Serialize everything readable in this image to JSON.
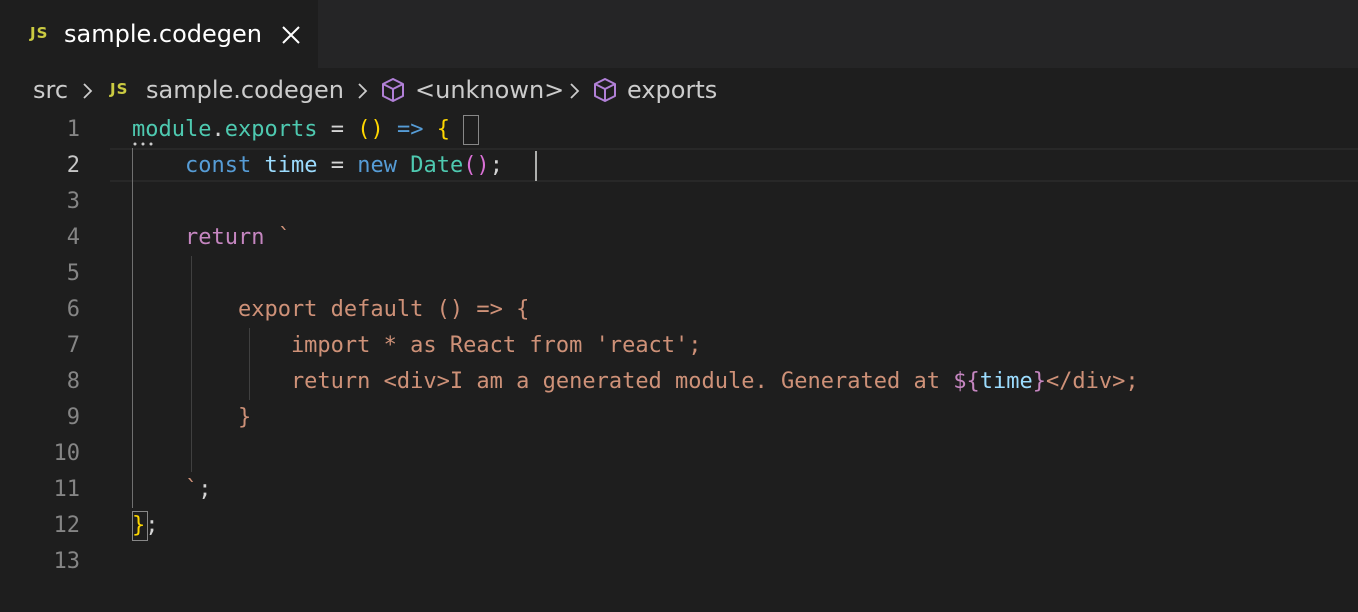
{
  "tab": {
    "icon_label": "JS",
    "title": "sample.codegen"
  },
  "breadcrumb": {
    "items": [
      {
        "label": "src"
      },
      {
        "label": "sample.codegen",
        "icon_label": "JS"
      },
      {
        "label": "<unknown>",
        "icon": "cube-icon"
      },
      {
        "label": "exports",
        "icon": "cube-icon"
      }
    ]
  },
  "editor": {
    "active_line": 2,
    "line_numbers": [
      "1",
      "2",
      "3",
      "4",
      "5",
      "6",
      "7",
      "8",
      "9",
      "10",
      "11",
      "12",
      "13"
    ],
    "lines": [
      [
        {
          "t": "module",
          "c": "mod"
        },
        {
          "t": ".",
          "c": "punc"
        },
        {
          "t": "exports",
          "c": "prop"
        },
        {
          "t": " = ",
          "c": "punc"
        },
        {
          "t": "()",
          "c": "brace-gold"
        },
        {
          "t": " ",
          "c": "punc"
        },
        {
          "t": "=>",
          "c": "arrow"
        },
        {
          "t": " ",
          "c": "punc"
        },
        {
          "t": "{",
          "c": "brace-gold"
        }
      ],
      [
        {
          "t": "    ",
          "c": "punc"
        },
        {
          "t": "const",
          "c": "kw-blue"
        },
        {
          "t": " ",
          "c": "punc"
        },
        {
          "t": "time",
          "c": "var"
        },
        {
          "t": " = ",
          "c": "punc"
        },
        {
          "t": "new",
          "c": "kw-blue"
        },
        {
          "t": " ",
          "c": "punc"
        },
        {
          "t": "Date",
          "c": "cls"
        },
        {
          "t": "()",
          "c": "brace-pink"
        },
        {
          "t": ";",
          "c": "punc"
        }
      ],
      [],
      [
        {
          "t": "    ",
          "c": "punc"
        },
        {
          "t": "return",
          "c": "kw-purple"
        },
        {
          "t": " `",
          "c": "str"
        }
      ],
      [],
      [
        {
          "t": "        export default () => {",
          "c": "str"
        }
      ],
      [
        {
          "t": "            import * as React from 'react';",
          "c": "str"
        }
      ],
      [
        {
          "t": "            return <div>I am a generated module. Generated at ",
          "c": "str"
        },
        {
          "t": "${",
          "c": "kw-purple"
        },
        {
          "t": "time",
          "c": "var"
        },
        {
          "t": "}",
          "c": "kw-purple"
        },
        {
          "t": "</div>;",
          "c": "str"
        }
      ],
      [
        {
          "t": "        }",
          "c": "str"
        }
      ],
      [],
      [
        {
          "t": "    `",
          "c": "str"
        },
        {
          "t": ";",
          "c": "punc"
        }
      ],
      [
        {
          "t": "}",
          "c": "brace-gold"
        },
        {
          "t": ";",
          "c": "punc"
        }
      ],
      []
    ]
  },
  "colors": {
    "background": "#1e1e1e",
    "tabbar": "#252526",
    "js_icon": "#cbcb41",
    "cube_icon": "#b180d7",
    "keyword_blue": "#569cd6",
    "keyword_purple": "#c586c0",
    "string": "#ce9178",
    "variable": "#9cdcfe",
    "type": "#4ec9b0",
    "bracket_gold": "#ffd700",
    "bracket_pink": "#da70d6"
  }
}
